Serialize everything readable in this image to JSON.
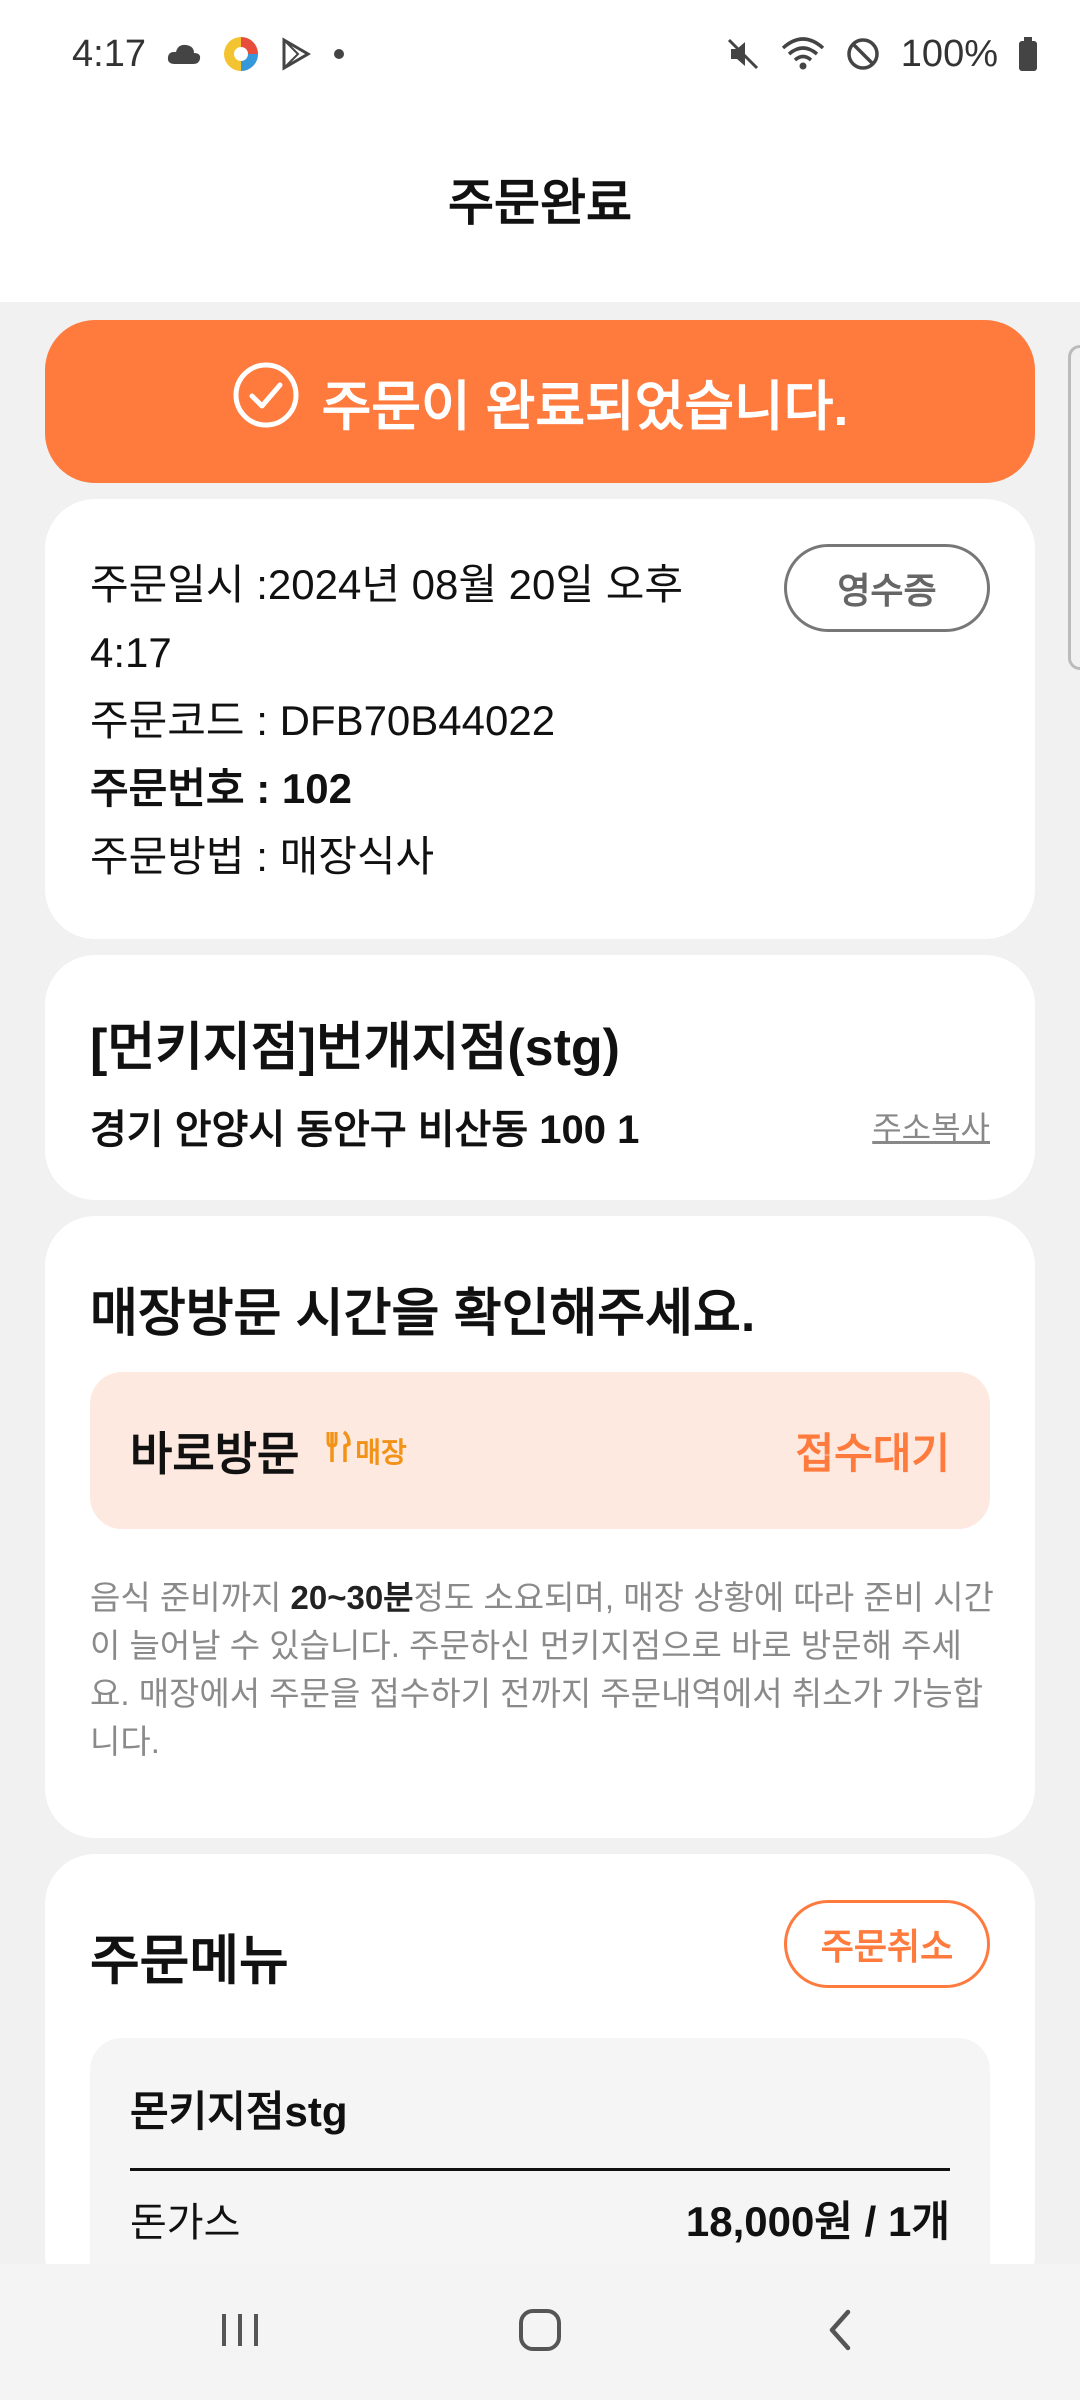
{
  "status_bar": {
    "time": "4:17",
    "battery": "100%",
    "icons_left": [
      "cloud-icon",
      "app-color-icon",
      "play-icon",
      "dot-icon"
    ],
    "icons_right": [
      "mute-icon",
      "wifi-icon",
      "block-icon",
      "battery-icon"
    ]
  },
  "header": {
    "title": "주문완료"
  },
  "banner": {
    "message": "주문이 완료되었습니다.",
    "icon": "check-circle-icon",
    "color": "#ff7a3d"
  },
  "order_info": {
    "datetime_label": "주문일시 :",
    "datetime_value": "2024년 08월 20일 오후 4:17",
    "code_label": "주문코드 : ",
    "code_value": "DFB70B44022",
    "number_label": "주문번호 : ",
    "number_value": "102",
    "method_label": "주문방법 : ",
    "method_value": "매장식사",
    "receipt_button": "영수증"
  },
  "store": {
    "name": "[먼키지점]번개지점(stg)",
    "address": "경기 안양시 동안구 비산동 100 1",
    "copy_address": "주소복사"
  },
  "visit": {
    "title": "매장방문 시간을 확인해주세요.",
    "type": "바로방문",
    "tag": "매장",
    "tag_icon": "fork-knife-icon",
    "status": "접수대기",
    "note_before": "음식 준비까지 ",
    "note_highlight": "20~30분",
    "note_after": "정도 소요되며, 매장 상황에 따라 준비 시간이 늘어날 수 있습니다. 주문하신 먼키지점으로 바로 방문해 주세요. 매장에서 주문을 접수하기 전까지 주문내역에서 취소가 가능합니다."
  },
  "menu": {
    "title": "주문메뉴",
    "cancel_button": "주문취소",
    "store_name": "몬키지점stg",
    "items": [
      {
        "name": "돈가스",
        "price": "18,000원 / 1개"
      }
    ]
  },
  "nav": {
    "buttons": [
      "recent-apps-icon",
      "home-icon",
      "back-icon"
    ]
  }
}
